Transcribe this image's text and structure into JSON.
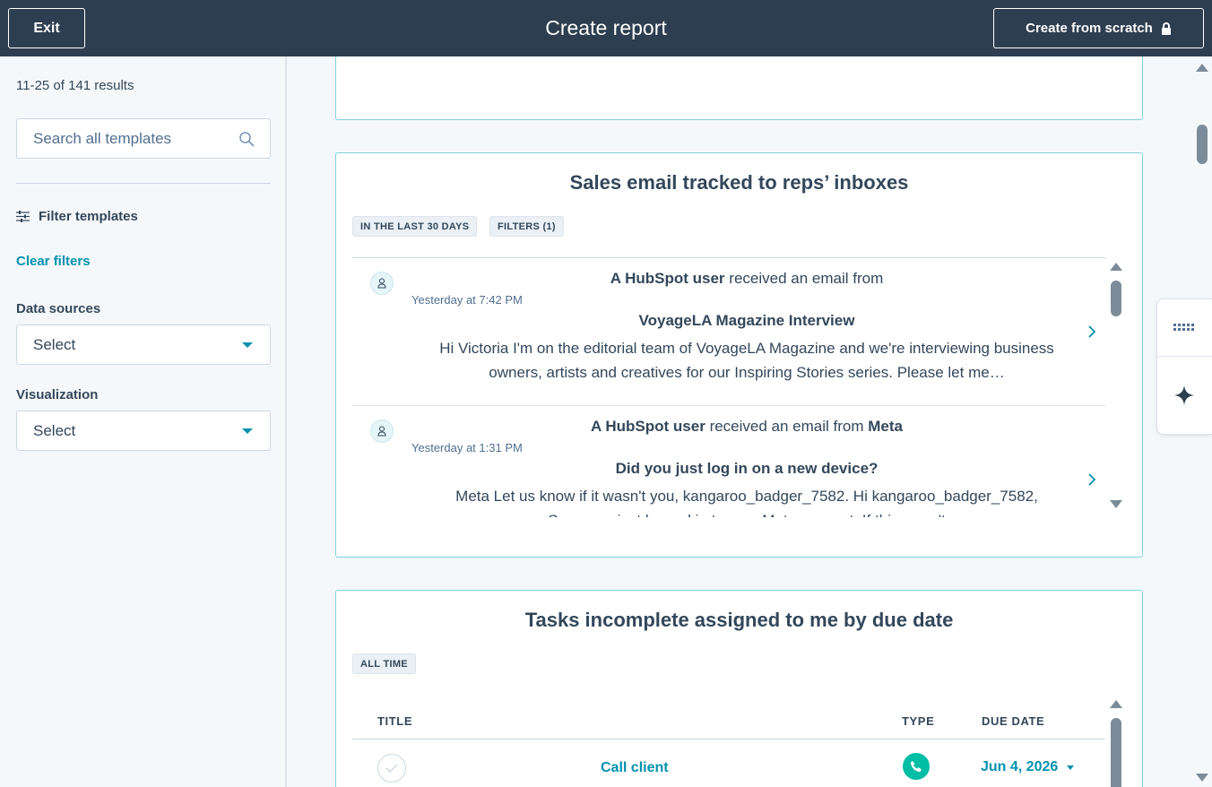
{
  "header": {
    "exit_label": "Exit",
    "title": "Create report",
    "create_from_scratch_label": "Create from scratch"
  },
  "sidebar": {
    "results_count": "11-25 of 141 results",
    "search_placeholder": "Search all templates",
    "filter_heading": "Filter templates",
    "clear_filters": "Clear filters",
    "data_sources_label": "Data sources",
    "data_sources_value": "Select",
    "visualization_label": "Visualization",
    "visualization_value": "Select"
  },
  "cards": {
    "sales_email": {
      "title": "Sales email tracked to reps’ inboxes",
      "tags": [
        "IN THE LAST 30 DAYS",
        "FILTERS (1)"
      ],
      "items": [
        {
          "actor": "A HubSpot user",
          "action": " received an email from",
          "sender": "",
          "time": "Yesterday at 7:42 PM",
          "subject": "VoyageLA Magazine Interview",
          "body": "Hi Victoria I'm on the editorial team of VoyageLA Magazine and we're interviewing business owners, artists and creatives for our Inspiring Stories series. Please let me…"
        },
        {
          "actor": "A HubSpot user",
          "action": " received an email from ",
          "sender": "Meta",
          "time": "Yesterday at 1:31 PM",
          "subject": "Did you just log in on a new device?",
          "body": "Meta        Let us know if it wasn't you, kangaroo_badger_7582.                    Hi kangaroo_badger_7582, Someone just logged in to your Meta account. If this wasn't"
        }
      ]
    },
    "tasks": {
      "title": "Tasks incomplete assigned to me by due date",
      "tags": [
        "ALL TIME"
      ],
      "columns": [
        "TITLE",
        "TYPE",
        "DUE DATE"
      ],
      "rows": [
        {
          "title": "Call client",
          "type_icon": "phone-icon",
          "due_date": "Jun 4, 2026"
        }
      ]
    }
  },
  "colors": {
    "header_bg": "#2d3e50",
    "accent_link": "#0091ae",
    "card_border": "#7fd1de",
    "call_type": "#00bda5"
  }
}
